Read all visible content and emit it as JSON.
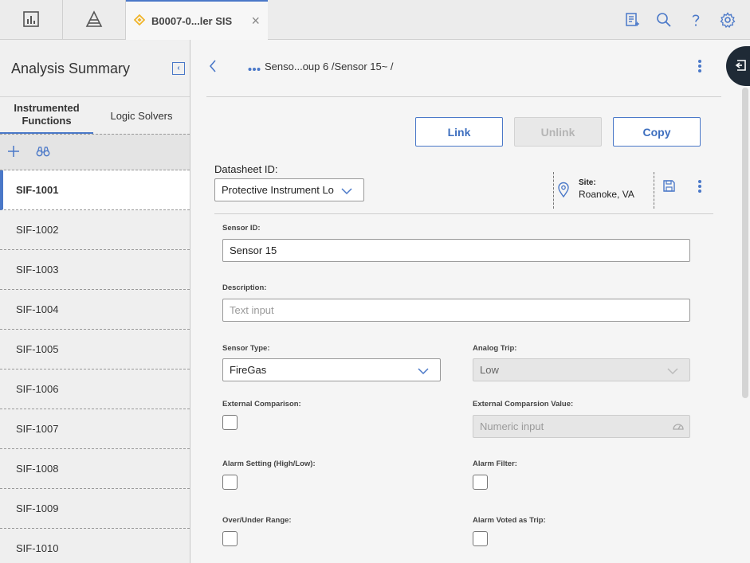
{
  "topbar": {
    "tab_label": "B0007-0...ler SIS",
    "close_glyph": "×",
    "icons": [
      "dashboard-icon",
      "hierarchy-icon",
      "tab-diamond-icon",
      "queue-icon",
      "search-icon",
      "help-icon",
      "gear-icon"
    ]
  },
  "left": {
    "title": "Analysis Summary",
    "collapse_glyph": "‹",
    "tabs": [
      {
        "label": "Instrumented Functions",
        "line1": "Instrumented",
        "line2": "Functions"
      },
      {
        "label": "Logic Solvers"
      }
    ],
    "items": [
      "SIF-1001",
      "SIF-1002",
      "SIF-1003",
      "SIF-1004",
      "SIF-1005",
      "SIF-1006",
      "SIF-1007",
      "SIF-1008",
      "SIF-1009",
      "SIF-1010"
    ],
    "selected_item": "SIF-1001"
  },
  "main": {
    "breadcrumb": "Senso...oup 6 /Sensor 15~ /",
    "actions": {
      "link": "Link",
      "unlink": "Unlink",
      "copy": "Copy"
    },
    "datasheet": {
      "label": "Datasheet ID:",
      "value": "Protective Instrument Lo",
      "site_label": "Site:",
      "site_value": "Roanoke, VA"
    },
    "form": {
      "sensor_id": {
        "label": "Sensor ID:",
        "value": "Sensor 15"
      },
      "description": {
        "label": "Description:",
        "placeholder": "Text input"
      },
      "sensor_type": {
        "label": "Sensor Type:",
        "value": "FireGas"
      },
      "analog_trip": {
        "label": "Analog Trip:",
        "value": "Low"
      },
      "external_comparison": {
        "label": "External Comparison:",
        "checked": false
      },
      "external_comparison_value": {
        "label": "External Comparsion Value:",
        "placeholder": "Numeric input"
      },
      "alarm_setting": {
        "label": "Alarm Setting (High/Low):",
        "checked": false
      },
      "alarm_filter": {
        "label": "Alarm Filter:",
        "checked": false
      },
      "over_under_range": {
        "label": "Over/Under Range:",
        "checked": false
      },
      "alarm_voted_as_trip": {
        "label": "Alarm Voted as Trip:",
        "checked": false
      }
    }
  },
  "colors": {
    "accent": "#4a78c8",
    "dock": "#1f2a36",
    "tab_diamond": "#f0b429"
  }
}
